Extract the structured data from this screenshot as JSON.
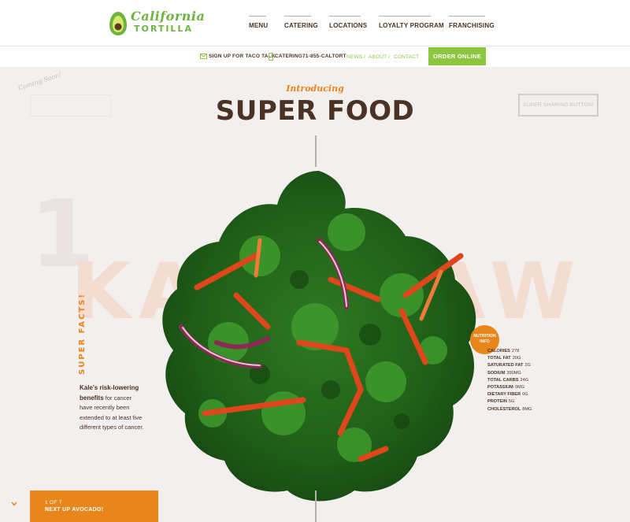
{
  "brand": {
    "line1": "California",
    "line2": "TORTILLA",
    "accent": "#8dc63f",
    "orange": "#e8861c",
    "brown": "#4a3324"
  },
  "nav": {
    "items": [
      "MENU",
      "CATERING",
      "LOCATIONS",
      "LOYALTY PROGRAM",
      "FRANCHISING"
    ]
  },
  "utility": {
    "signup_icon": "envelope-icon",
    "signup": "SIGN UP FOR TACO TALK",
    "phone_icon": "phone-icon",
    "catering": "CATERING71-855-CALTORT",
    "links": [
      "NEWS",
      "ABOUT",
      "CONTACT"
    ],
    "separator": "/",
    "order": "ORDER ONLINE"
  },
  "hero": {
    "coming_soon": "Coming Soon!",
    "share": "SUPER SHARING BUTTON!",
    "introducing": "Introducing",
    "title": "SUPER FOOD",
    "number": "1",
    "word": "KALE RAW"
  },
  "facts": {
    "label": "SUPER FACTS!",
    "bold": "Kale's risk-lowering benefits",
    "text": " for cancer have recently been extended to at least five different types of cancer."
  },
  "nutrition": {
    "badge": [
      "NUTRITION",
      "INFO"
    ],
    "rows": [
      {
        "k": "CALORIES",
        "v": "278"
      },
      {
        "k": "TOTAL FAT",
        "v": "20G"
      },
      {
        "k": "SATURATED FAT",
        "v": "2G"
      },
      {
        "k": "SODIUM",
        "v": "390MG"
      },
      {
        "k": "TOTAL CARBS",
        "v": "24G"
      },
      {
        "k": "POTASSIUM",
        "v": "0MG"
      },
      {
        "k": "DIETARY FIBER",
        "v": "0G"
      },
      {
        "k": "PROTEIN",
        "v": "5G"
      },
      {
        "k": "CHOLESTEROL",
        "v": "8MG"
      }
    ]
  },
  "next": {
    "count": "1 OF 7",
    "label": "NEXT UP AVOCADO!",
    "chevron": "chevron-down-icon"
  }
}
